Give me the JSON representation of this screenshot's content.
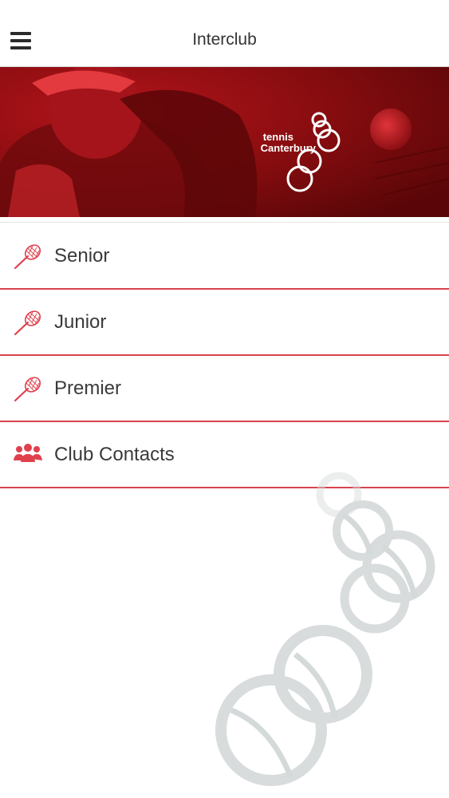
{
  "header": {
    "title": "Interclub",
    "menu_icon": "hamburger-menu-icon"
  },
  "banner": {
    "logo_line1": "tennis",
    "logo_line2": "Canterbury",
    "accent_color": "#c5161d"
  },
  "menu": {
    "items": [
      {
        "label": "Senior",
        "icon": "tennis-racket-icon"
      },
      {
        "label": "Junior",
        "icon": "tennis-racket-icon"
      },
      {
        "label": "Premier",
        "icon": "tennis-racket-icon"
      },
      {
        "label": "Club Contacts",
        "icon": "group-people-icon"
      }
    ],
    "divider_color": "#d9434e",
    "icon_color": "#e0404c"
  }
}
